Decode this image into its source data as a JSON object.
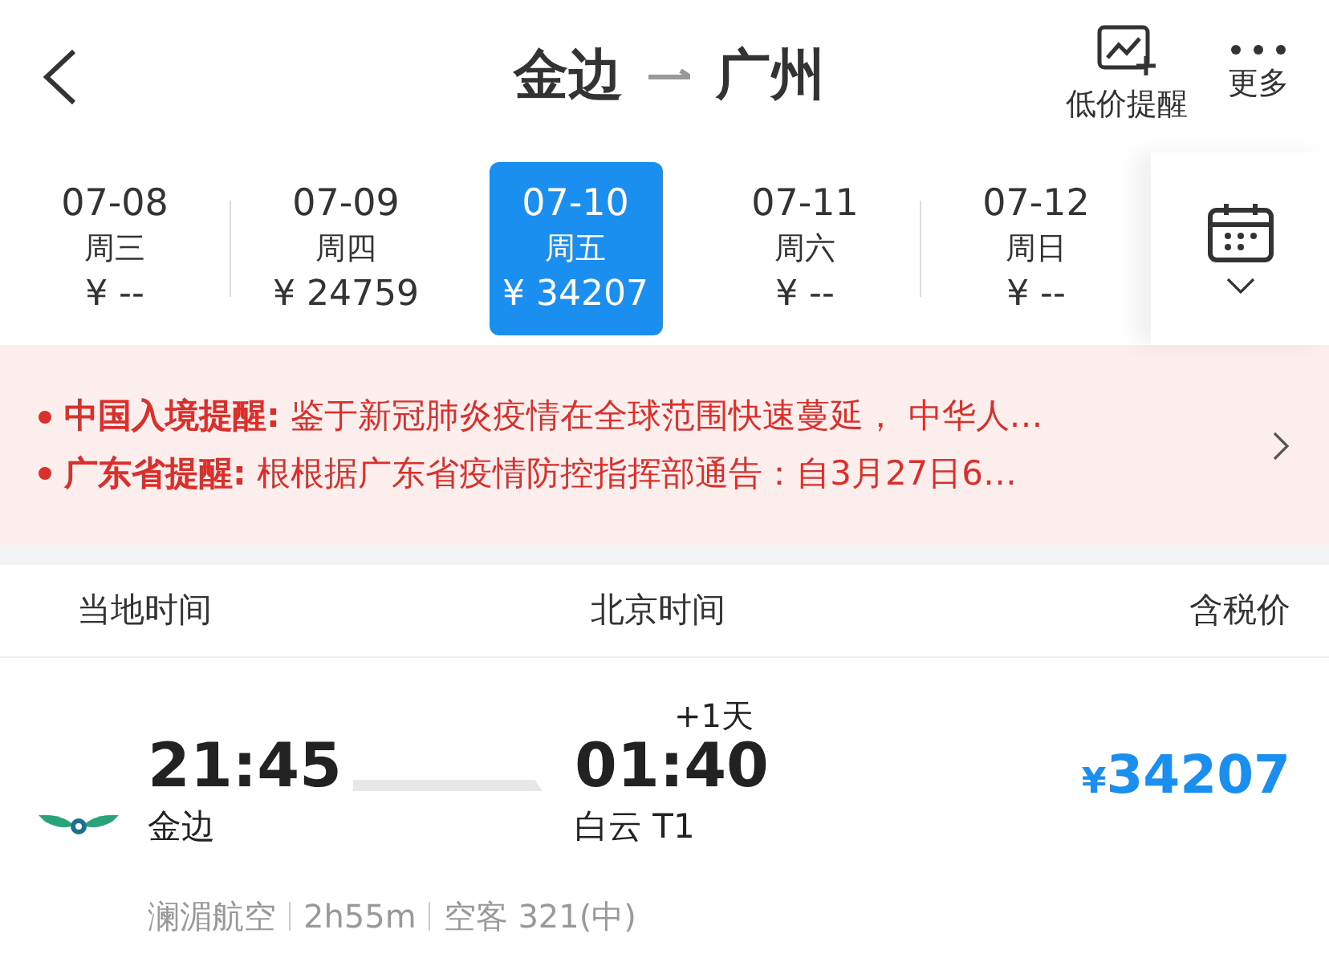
{
  "header": {
    "origin": "金边",
    "destination": "广州",
    "actions": [
      {
        "kind": "alert",
        "label": "低价提醒"
      },
      {
        "kind": "more",
        "label": "更多"
      }
    ]
  },
  "dates": [
    {
      "date": "07-08",
      "weekday": "周三",
      "price": "¥ --",
      "selected": false
    },
    {
      "date": "07-09",
      "weekday": "周四",
      "price": "¥ 24759",
      "selected": false
    },
    {
      "date": "07-10",
      "weekday": "周五",
      "price": "¥ 34207",
      "selected": true
    },
    {
      "date": "07-11",
      "weekday": "周六",
      "price": "¥ --",
      "selected": false
    },
    {
      "date": "07-12",
      "weekday": "周日",
      "price": "¥ --",
      "selected": false
    }
  ],
  "notices": [
    "**中国入境提醒:** 鉴于新冠肺炎疫情在全球范围快速蔓延， 中华人…",
    "**广东省提醒:** 根根据广东省疫情防控指挥部通告：自3月27日6…"
  ],
  "columns": [
    "当地时间",
    "北京时间",
    "含税价"
  ],
  "flights": [
    {
      "depart_time": "21:45",
      "depart_airport": "金边",
      "arrive_time": "01:40",
      "arrive_airport": "白云 T1",
      "day_offset": "+1天",
      "currency": "¥",
      "price": "34207",
      "airline": "澜湄航空",
      "duration": "2h55m",
      "aircraft": "空客 321(中)"
    }
  ]
}
